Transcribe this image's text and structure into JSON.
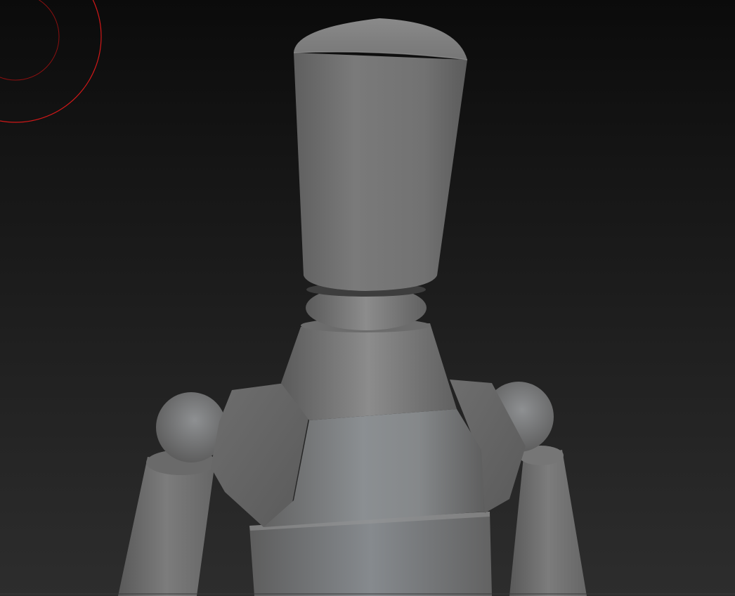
{
  "viewport": {
    "mode": "3d-sculpt",
    "model": "mannequin",
    "background_top": "#0b0b0b",
    "background_bottom": "#2d2d2d",
    "cursor_color": "#d01818",
    "model_color": "#7a7a7a"
  }
}
